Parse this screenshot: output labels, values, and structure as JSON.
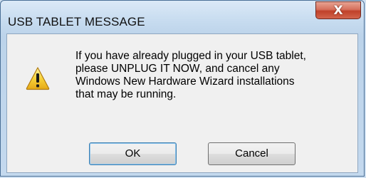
{
  "window": {
    "title": "USB TABLET MESSAGE",
    "close_glyph": "X"
  },
  "dialog": {
    "icon": "warning-icon",
    "message": "If you have already plugged in your USB tablet,\nplease UNPLUG IT NOW, and cancel any\nWindows New Hardware Wizard installations\nthat may be running."
  },
  "buttons": {
    "ok_label": "OK",
    "cancel_label": "Cancel"
  }
}
